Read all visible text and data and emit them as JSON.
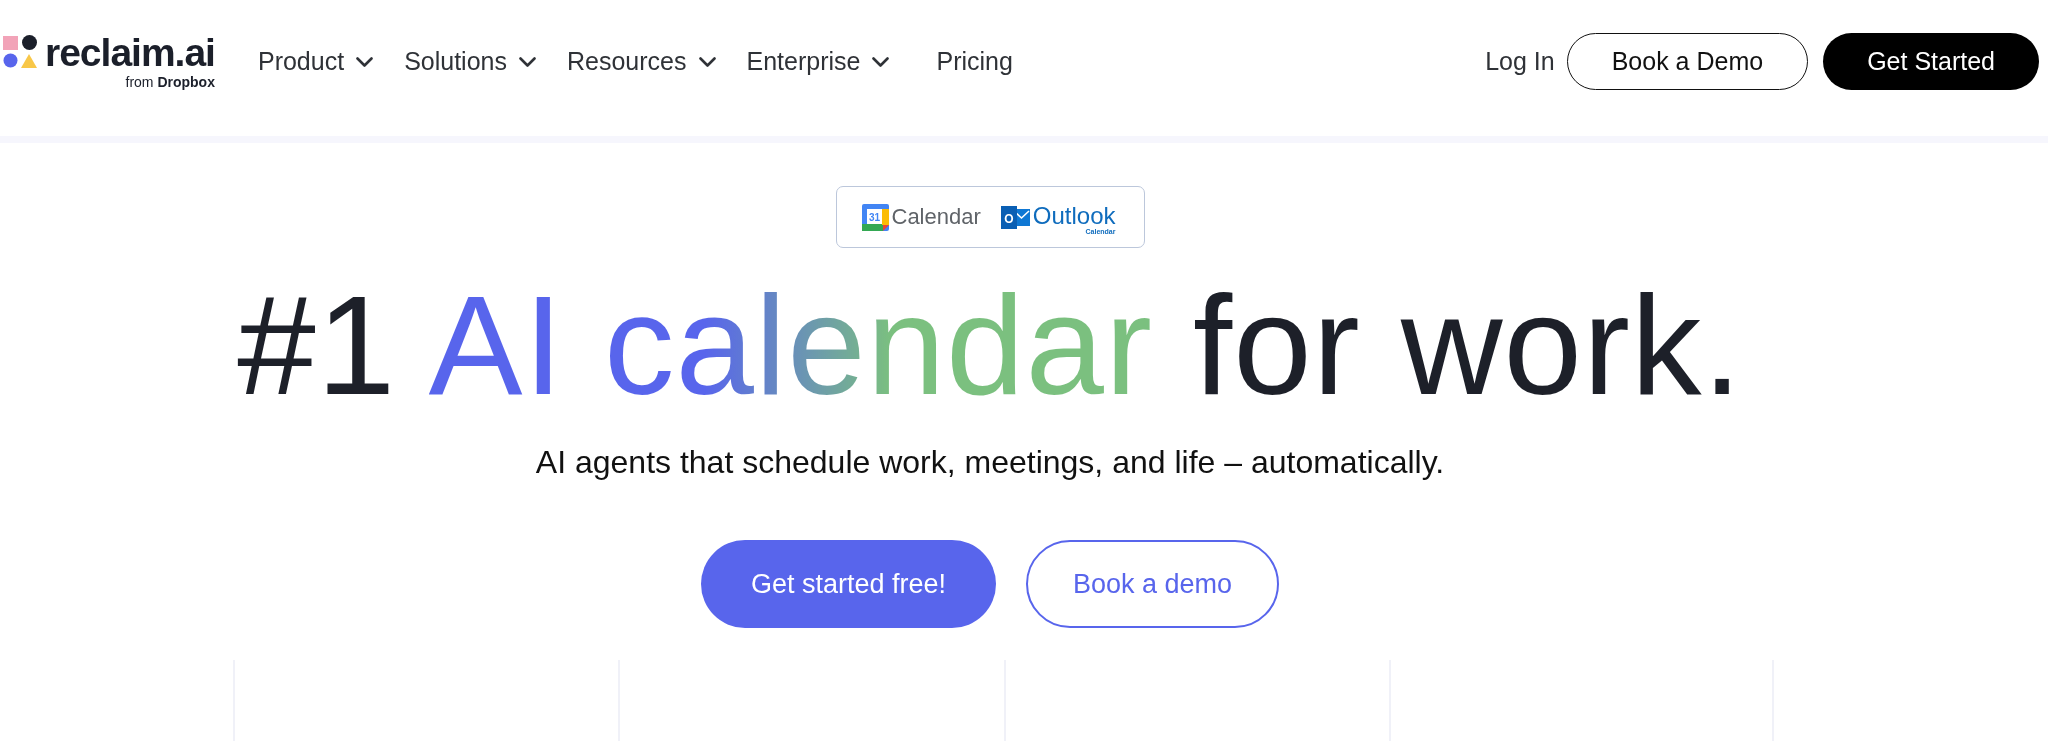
{
  "header": {
    "logo": {
      "name": "reclaim.ai",
      "tagline": "from **Dropbox**"
    },
    "nav": [
      {
        "label": "Product",
        "dropdown": true
      },
      {
        "label": "Solutions",
        "dropdown": true
      },
      {
        "label": "Resources",
        "dropdown": true
      },
      {
        "label": "Enterprise",
        "dropdown": true
      },
      {
        "label": "Pricing",
        "dropdown": false
      }
    ],
    "login": "Log In",
    "buttons": [
      {
        "label": "Book a Demo",
        "kind": "outline"
      },
      {
        "label": "Get Started",
        "kind": "solid"
      }
    ]
  },
  "hero": {
    "integrations": [
      {
        "kind": "google",
        "icon_text": "31",
        "label": "Calendar"
      },
      {
        "kind": "outlook",
        "icon_text": "O",
        "label": "Outlook",
        "sublabel": "Calendar"
      }
    ],
    "headline": [
      {
        "text": "#1",
        "kind": "plain"
      },
      {
        "text": "AI calendar",
        "kind": "gradient"
      },
      {
        "text": "for work.",
        "kind": "plain"
      }
    ],
    "subtitle": "AI agents that schedule work, meetings, and life – automatically.",
    "buttons": [
      {
        "label": "Get started free!",
        "kind": "primary"
      },
      {
        "label": "Book a demo",
        "kind": "secondary"
      }
    ]
  }
}
